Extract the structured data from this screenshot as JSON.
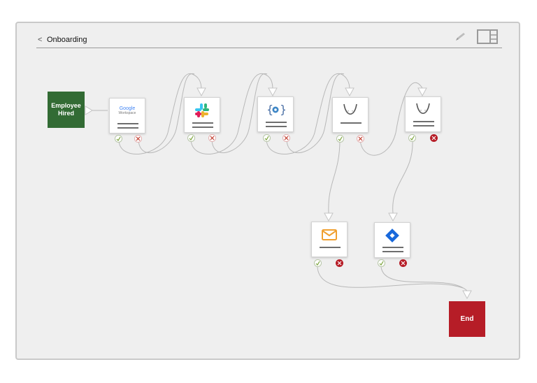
{
  "header": {
    "back_glyph": "<",
    "title": "Onboarding"
  },
  "toolbar": {
    "edit_icon": "pencil-icon",
    "layout_icon": "panel-layout-icon"
  },
  "trigger": {
    "label": "Employee Hired",
    "color": "#326b34"
  },
  "end": {
    "label": "End",
    "color": "#b61d27"
  },
  "steps": [
    {
      "id": "google-workspace",
      "icon": "google-workspace-logo",
      "logo_text": "Google",
      "logo_sub": "Workspace",
      "fail_style": "outline"
    },
    {
      "id": "slack",
      "icon": "slack-logo",
      "fail_style": "outline"
    },
    {
      "id": "code",
      "icon": "code-gear-icon",
      "fail_style": "outline"
    },
    {
      "id": "function-1",
      "icon": "function-curve-icon",
      "fail_style": "outline"
    },
    {
      "id": "function-2",
      "icon": "function-curve-icon",
      "fail_style": "solid"
    },
    {
      "id": "email",
      "icon": "mail-icon",
      "fail_style": "solid"
    },
    {
      "id": "jira",
      "icon": "jira-logo",
      "fail_style": "solid"
    }
  ],
  "colors": {
    "frame_bg": "#efefef",
    "success": "#7aa33a",
    "failure": "#b61d27",
    "wire": "#b8b8b8"
  }
}
